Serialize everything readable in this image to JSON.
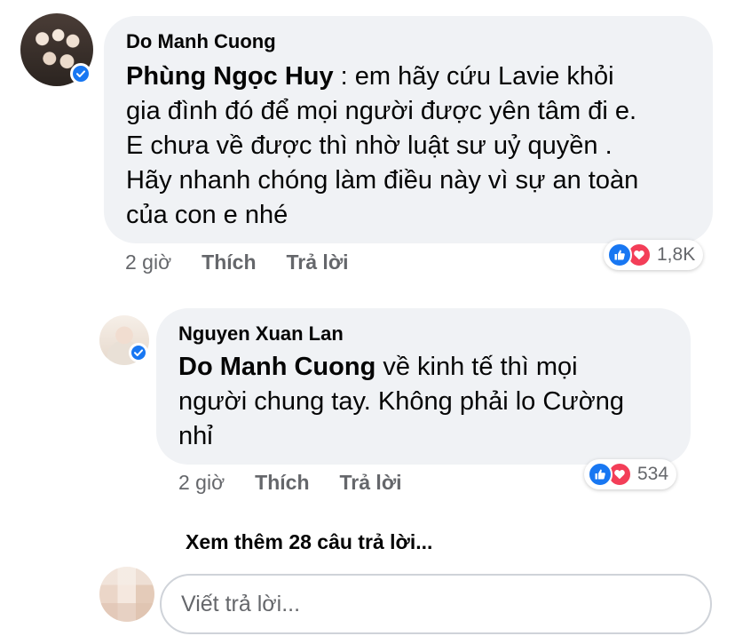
{
  "comment": {
    "author": "Do Manh Cuong",
    "mention": "Phùng Ngọc Huy",
    "lines": [
      " : em hãy cứu Lavie khỏi",
      "gia đình đó để mọi người được yên tâm đi e.",
      "E chưa về được thì nhờ luật sư uỷ quyền .",
      "Hãy nhanh chóng làm điều này vì sự an toàn",
      "của con e nhé"
    ],
    "time": "2 giờ",
    "like_label": "Thích",
    "reply_label": "Trả lời",
    "reaction_count": "1,8K",
    "reactions": [
      "like-icon",
      "love-icon"
    ]
  },
  "reply": {
    "author": "Nguyen Xuan Lan",
    "mention": "Do Manh Cuong",
    "lines": [
      " về kinh tế thì mọi",
      "người chung tay. Không phải lo Cường",
      "nhỉ"
    ],
    "time": "2 giờ",
    "like_label": "Thích",
    "reply_label": "Trả lời",
    "reaction_count": "534",
    "reactions": [
      "like-icon",
      "love-icon"
    ]
  },
  "view_more": "Xem thêm 28 câu trả lời...",
  "composer": {
    "placeholder": "Viết trả lời..."
  },
  "colors": {
    "bubble": "#f0f2f5",
    "meta_text": "#65676b",
    "like_blue": "#1877f2",
    "love_red": "#f33e58"
  }
}
